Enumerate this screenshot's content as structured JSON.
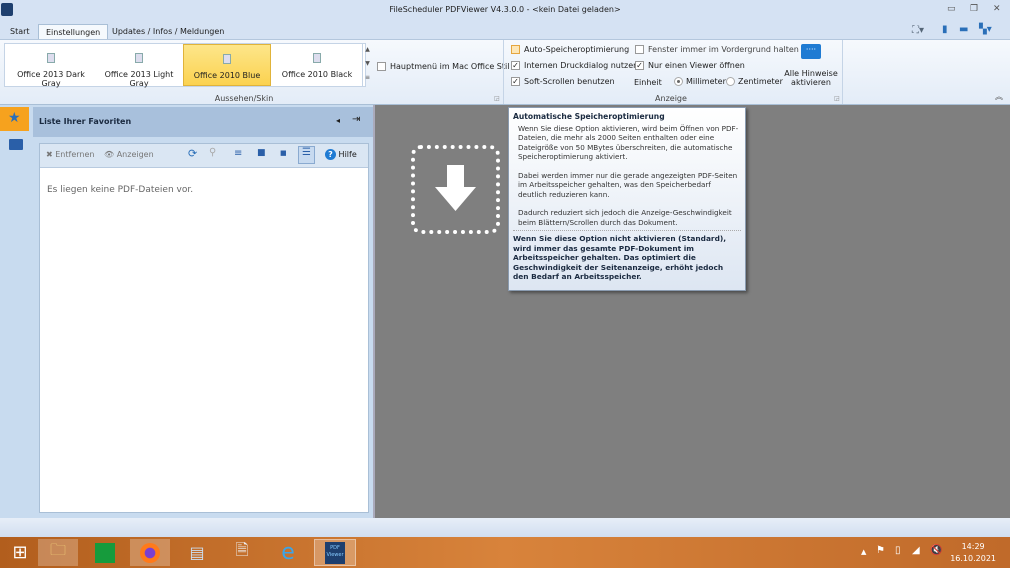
{
  "window": {
    "title": "FileScheduler PDFViewer V4.3.0.0 - <kein Datei geladen>",
    "app_icon_text": "PDF"
  },
  "tabs": [
    {
      "label": "Start"
    },
    {
      "label": "Einstellungen"
    },
    {
      "label": "Updates / Infos / Meldungen"
    }
  ],
  "ribbon": {
    "skins": [
      {
        "label": "Office 2013 Dark Gray"
      },
      {
        "label": "Office 2013 Light Gray"
      },
      {
        "label": "Office 2010 Blue",
        "selected": true
      },
      {
        "label": "Office 2010 Black"
      }
    ],
    "mac_style": {
      "label": "Hauptmenü im Mac Office Stil",
      "checked": false
    },
    "skin_group": "Aussehen/Skin",
    "options": [
      {
        "label": "Auto-Speicheroptimierung",
        "checked": false
      },
      {
        "label": "Internen Druckdialog nutzen",
        "checked": true
      },
      {
        "label": "Soft-Scrollen benutzen",
        "checked": true
      },
      {
        "label": "Fenster immer im Vordergrund halten",
        "checked": false
      },
      {
        "label": "Nur einen Viewer öffnen",
        "checked": true
      }
    ],
    "unit_label": "Einheit",
    "units": [
      {
        "label": "Millimeter",
        "selected": true
      },
      {
        "label": "Zentimeter",
        "selected": false
      }
    ],
    "hints_button": "Alle Hinweise aktivieren",
    "display_group": "Anzeige"
  },
  "panel": {
    "title": "Liste Ihrer Favoriten",
    "remove": "Entfernen",
    "show": "Anzeigen",
    "help": "Hilfe",
    "empty": "Es liegen keine PDF-Dateien vor."
  },
  "tooltip": {
    "title": "Automatische Speicheroptimierung",
    "p1": "Wenn Sie diese Option aktivieren, wird beim Öffnen von PDF-Dateien, die mehr als 2000 Seiten enthalten oder eine Dateigröße von 50 MBytes überschreiten, die automatische Speicheroptimierung aktiviert.",
    "p2": "Dabei werden immer nur die gerade angezeigten PDF-Seiten im Arbeitsspeicher gehalten, was den Speicherbedarf deutlich reduzieren kann.",
    "p3": "Dadurch reduziert sich jedoch die Anzeige-Geschwindigkeit beim Blättern/Scrollen durch das Dokument.",
    "footer": "Wenn Sie diese Option nicht aktivieren (Standard), wird immer das gesamte PDF-Dokument im Arbeitsspeicher gehalten. Das optimiert die Geschwindigkeit der Seitenanzeige, erhöht jedoch den Bedarf an Arbeitsspeicher."
  },
  "taskbar": {
    "time": "14:29",
    "date": "16.10.2021",
    "pdf_viewer_icon_text": "PDF Viewer"
  }
}
